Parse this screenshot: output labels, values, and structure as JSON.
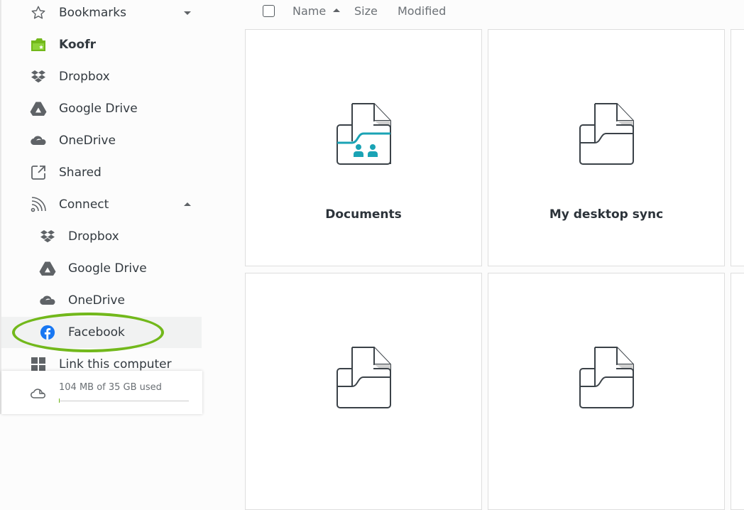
{
  "sidebar": {
    "bookmarks": {
      "label": "Bookmarks",
      "icon": "star-icon",
      "expanded": false
    },
    "places": [
      {
        "label": "Koofr",
        "icon": "koofr-icon",
        "bold": true
      },
      {
        "label": "Dropbox",
        "icon": "dropbox-icon"
      },
      {
        "label": "Google Drive",
        "icon": "google-drive-icon"
      },
      {
        "label": "OneDrive",
        "icon": "onedrive-icon"
      },
      {
        "label": "Shared",
        "icon": "shared-icon"
      }
    ],
    "connect": {
      "label": "Connect",
      "icon": "connect-icon",
      "expanded": true,
      "items": [
        {
          "label": "Dropbox",
          "icon": "dropbox-icon"
        },
        {
          "label": "Google Drive",
          "icon": "google-drive-icon"
        },
        {
          "label": "OneDrive",
          "icon": "onedrive-icon"
        },
        {
          "label": "Facebook",
          "icon": "facebook-icon",
          "selected": true
        }
      ]
    },
    "link_computer": {
      "label": "Link this computer",
      "icon": "windows-icon"
    },
    "storage": {
      "text": "104 MB of 35 GB used",
      "used_fraction": 0.003,
      "icon": "cloud-usage-icon"
    }
  },
  "toolbar": {
    "columns": [
      {
        "label": "Name",
        "sorted": "asc"
      },
      {
        "label": "Size"
      },
      {
        "label": "Modified"
      }
    ]
  },
  "files": [
    {
      "name": "Documents",
      "type": "shared-folder"
    },
    {
      "name": "My desktop sync",
      "type": "folder"
    },
    {
      "name": "",
      "type": "folder"
    },
    {
      "name": "",
      "type": "folder"
    },
    {
      "name": "",
      "type": "folder"
    }
  ],
  "colors": {
    "accent": "#72b81b",
    "folder_shared": "#1aa3b5",
    "facebook": "#1877f2",
    "icon_gray": "#5f6367"
  }
}
